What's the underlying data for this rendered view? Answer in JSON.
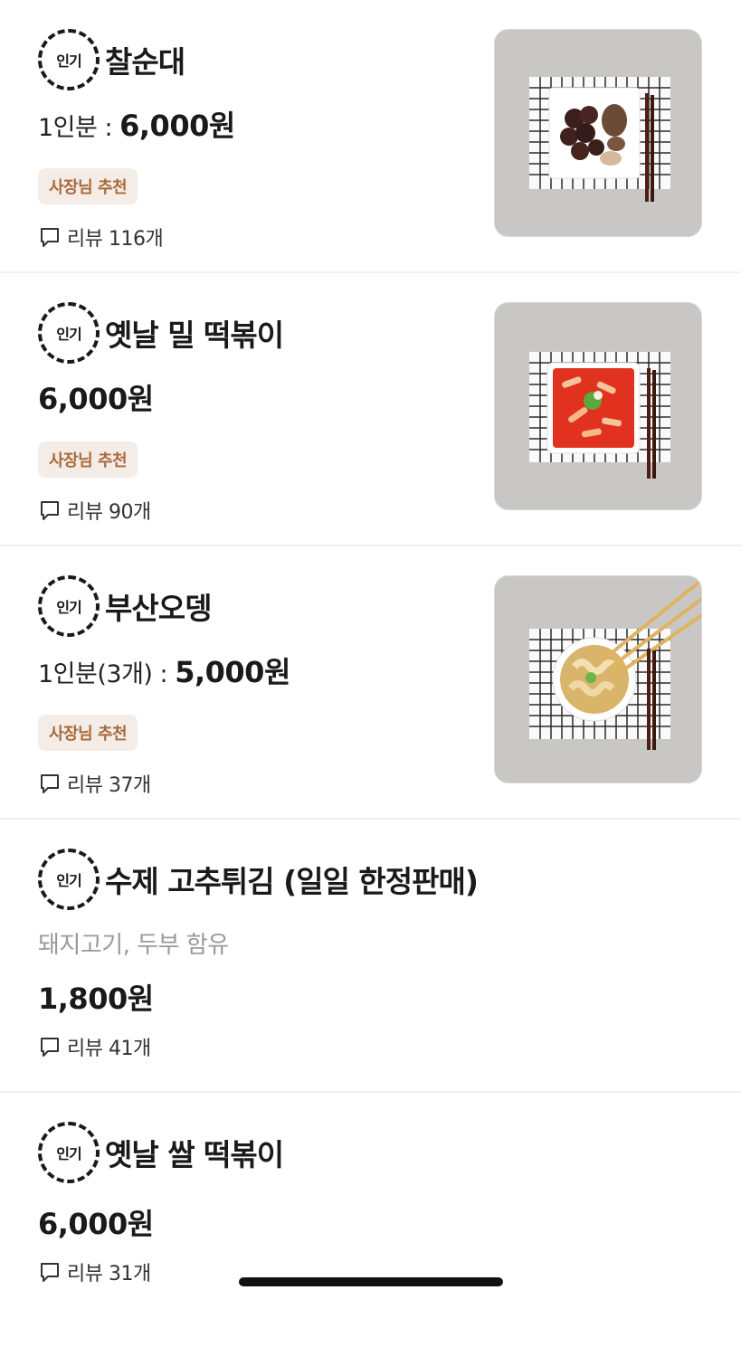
{
  "popular_badge": "인기",
  "recommend_badge": "사장님 추천",
  "items": [
    {
      "name": "찰순대",
      "price_prefix": "1인분 : ",
      "price": "6,000원",
      "review": "리뷰 116개",
      "image_icon": "sundae-plate-photo"
    },
    {
      "name": "옛날 밀 떡볶이",
      "price_prefix": "",
      "price": "6,000원",
      "review": "리뷰 90개",
      "image_icon": "tteokbokki-bowl-photo"
    },
    {
      "name": "부산오뎅",
      "price_prefix": "1인분(3개) : ",
      "price": "5,000원",
      "review": "리뷰 37개",
      "image_icon": "fishcake-skewer-photo"
    },
    {
      "name": "수제 고추튀김 (일일 한정판매)",
      "description": "돼지고기, 두부 함유",
      "price": "1,800원",
      "review": "리뷰 41개"
    },
    {
      "name": "옛날 쌀 떡볶이",
      "price": "6,000원",
      "review": "리뷰 31개"
    }
  ]
}
